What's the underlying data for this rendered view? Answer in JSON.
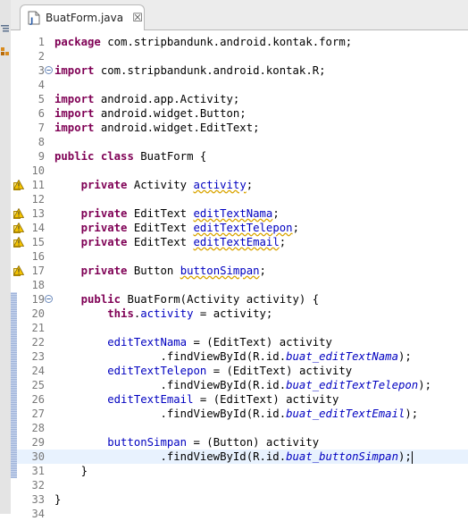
{
  "tab": {
    "label": "BuatForm.java",
    "close": "☒"
  },
  "lines": [
    {
      "n": "1",
      "t": [
        {
          "k": "kw",
          "v": "package"
        },
        {
          "v": " com.stripbandunk.android.kontak.form;"
        }
      ]
    },
    {
      "n": "2",
      "t": []
    },
    {
      "n": "3",
      "fold": "collapse",
      "t": [
        {
          "k": "kw",
          "v": "import"
        },
        {
          "v": " com.stripbandunk.android.kontak.R;"
        }
      ]
    },
    {
      "n": "4",
      "t": []
    },
    {
      "n": "5",
      "t": [
        {
          "k": "kw",
          "v": "import"
        },
        {
          "v": " android.app.Activity;"
        }
      ]
    },
    {
      "n": "6",
      "t": [
        {
          "k": "kw",
          "v": "import"
        },
        {
          "v": " android.widget.Button;"
        }
      ]
    },
    {
      "n": "7",
      "t": [
        {
          "k": "kw",
          "v": "import"
        },
        {
          "v": " android.widget.EditText;"
        }
      ]
    },
    {
      "n": "8",
      "t": []
    },
    {
      "n": "9",
      "t": [
        {
          "k": "kw",
          "v": "public"
        },
        {
          "v": " "
        },
        {
          "k": "kw",
          "v": "class"
        },
        {
          "v": " BuatForm {"
        }
      ]
    },
    {
      "n": "10",
      "t": []
    },
    {
      "n": "11",
      "warn": true,
      "t": [
        {
          "v": "    "
        },
        {
          "k": "kw",
          "v": "private"
        },
        {
          "v": " Activity "
        },
        {
          "k": "fld warn",
          "v": "activity"
        },
        {
          "v": ";"
        }
      ]
    },
    {
      "n": "12",
      "t": []
    },
    {
      "n": "13",
      "warn": true,
      "t": [
        {
          "v": "    "
        },
        {
          "k": "kw",
          "v": "private"
        },
        {
          "v": " EditText "
        },
        {
          "k": "fld warn",
          "v": "editTextNama"
        },
        {
          "v": ";"
        }
      ]
    },
    {
      "n": "14",
      "warn": true,
      "t": [
        {
          "v": "    "
        },
        {
          "k": "kw",
          "v": "private"
        },
        {
          "v": " EditText "
        },
        {
          "k": "fld warn",
          "v": "editTextTelepon"
        },
        {
          "v": ";"
        }
      ]
    },
    {
      "n": "15",
      "warn": true,
      "t": [
        {
          "v": "    "
        },
        {
          "k": "kw",
          "v": "private"
        },
        {
          "v": " EditText "
        },
        {
          "k": "fld warn",
          "v": "editTextEmail"
        },
        {
          "v": ";"
        }
      ]
    },
    {
      "n": "16",
      "t": []
    },
    {
      "n": "17",
      "warn": true,
      "t": [
        {
          "v": "    "
        },
        {
          "k": "kw",
          "v": "private"
        },
        {
          "v": " Button "
        },
        {
          "k": "fld warn",
          "v": "buttonSimpan"
        },
        {
          "v": ";"
        }
      ]
    },
    {
      "n": "18",
      "t": []
    },
    {
      "n": "19",
      "fold": "collapse",
      "range": true,
      "t": [
        {
          "v": "    "
        },
        {
          "k": "kw",
          "v": "public"
        },
        {
          "v": " BuatForm(Activity activity) {"
        }
      ]
    },
    {
      "n": "20",
      "range": true,
      "t": [
        {
          "v": "        "
        },
        {
          "k": "kw",
          "v": "this"
        },
        {
          "v": "."
        },
        {
          "k": "fld",
          "v": "activity"
        },
        {
          "v": " = activity;"
        }
      ]
    },
    {
      "n": "21",
      "range": true,
      "t": []
    },
    {
      "n": "22",
      "range": true,
      "t": [
        {
          "v": "        "
        },
        {
          "k": "fld",
          "v": "editTextNama"
        },
        {
          "v": " = (EditText) activity"
        }
      ]
    },
    {
      "n": "23",
      "range": true,
      "t": [
        {
          "v": "                .findViewById(R.id."
        },
        {
          "k": "st",
          "v": "buat_editTextNama"
        },
        {
          "v": ");"
        }
      ]
    },
    {
      "n": "24",
      "range": true,
      "t": [
        {
          "v": "        "
        },
        {
          "k": "fld",
          "v": "editTextTelepon"
        },
        {
          "v": " = (EditText) activity"
        }
      ]
    },
    {
      "n": "25",
      "range": true,
      "t": [
        {
          "v": "                .findViewById(R.id."
        },
        {
          "k": "st",
          "v": "buat_editTextTelepon"
        },
        {
          "v": ");"
        }
      ]
    },
    {
      "n": "26",
      "range": true,
      "t": [
        {
          "v": "        "
        },
        {
          "k": "fld",
          "v": "editTextEmail"
        },
        {
          "v": " = (EditText) activity"
        }
      ]
    },
    {
      "n": "27",
      "range": true,
      "t": [
        {
          "v": "                .findViewById(R.id."
        },
        {
          "k": "st",
          "v": "buat_editTextEmail"
        },
        {
          "v": ");"
        }
      ]
    },
    {
      "n": "28",
      "range": true,
      "t": []
    },
    {
      "n": "29",
      "range": true,
      "t": [
        {
          "v": "        "
        },
        {
          "k": "fld",
          "v": "buttonSimpan"
        },
        {
          "v": " = (Button) activity"
        }
      ]
    },
    {
      "n": "30",
      "range": true,
      "current": true,
      "t": [
        {
          "v": "                .findViewById(R.id."
        },
        {
          "k": "st",
          "v": "buat_buttonSimpan"
        },
        {
          "v": ");"
        }
      ]
    },
    {
      "n": "31",
      "range": true,
      "t": [
        {
          "v": "    }"
        }
      ]
    },
    {
      "n": "32",
      "t": []
    },
    {
      "n": "33",
      "t": [
        {
          "v": "}"
        }
      ]
    },
    {
      "n": "34",
      "t": []
    }
  ]
}
